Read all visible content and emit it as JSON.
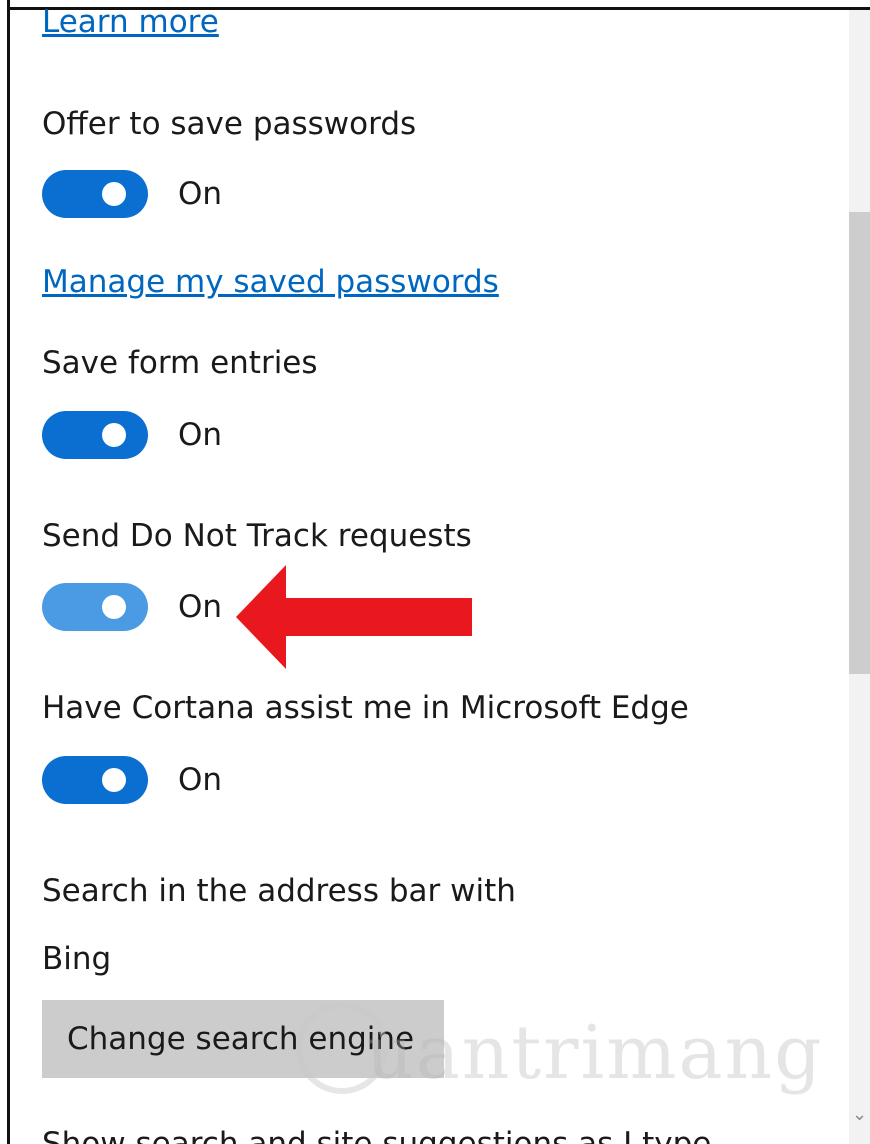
{
  "links": {
    "learn_more": "Learn more",
    "manage_passwords": "Manage my saved passwords"
  },
  "settings": [
    {
      "label": "Offer to save passwords",
      "state": "On",
      "enabled": true
    },
    {
      "label": "Save form entries",
      "state": "On",
      "enabled": true
    },
    {
      "label": "Send Do Not Track requests",
      "state": "On",
      "enabled": true
    },
    {
      "label": "Have Cortana assist me in Microsoft Edge",
      "state": "On",
      "enabled": true
    }
  ],
  "search": {
    "label": "Search in the address bar with",
    "engine": "Bing",
    "change_button": "Change search engine",
    "next_label": "Show search and site suggestions as I type"
  },
  "watermark": {
    "text": "uantrimang"
  },
  "colors": {
    "toggle_on": "#0a6fd1",
    "toggle_on_light": "#4a9be3",
    "link": "#0067c0",
    "button_bg": "#cccccc",
    "arrow": "#e8181e"
  },
  "icons": {
    "annotation": "red-arrow-icon",
    "scroll_down": "chevron-down-icon"
  }
}
